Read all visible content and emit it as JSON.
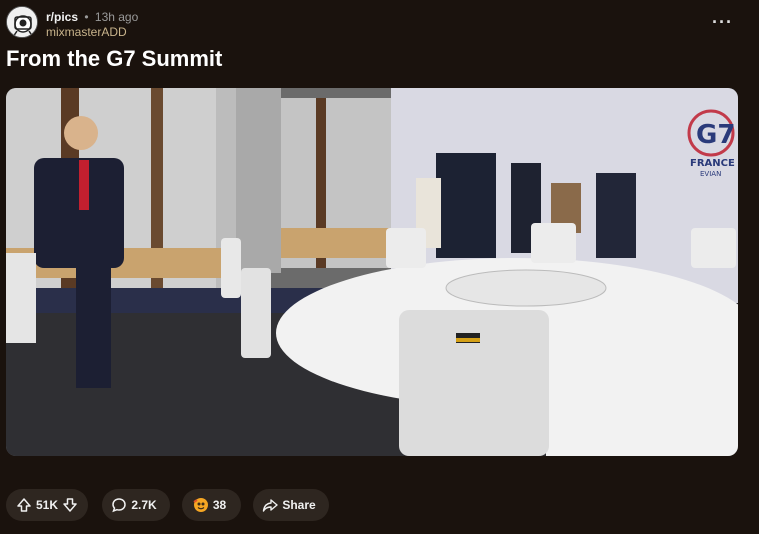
{
  "post": {
    "subreddit": "r/pics",
    "separator": "•",
    "time_ago": "13h ago",
    "username": "mixmasterADD",
    "title": "From the G7 Summit",
    "more_label": "···",
    "media": {
      "banner_logo_text": "G7",
      "banner_country": "FRANCE",
      "banner_city": "EVIAN"
    }
  },
  "actions": {
    "upvotes": "51K",
    "comments": "2.7K",
    "awards": "38",
    "share": "Share"
  },
  "colors": {
    "background": "#1a120d",
    "pill_bg": "#2e2620",
    "username": "#c9b48c"
  }
}
